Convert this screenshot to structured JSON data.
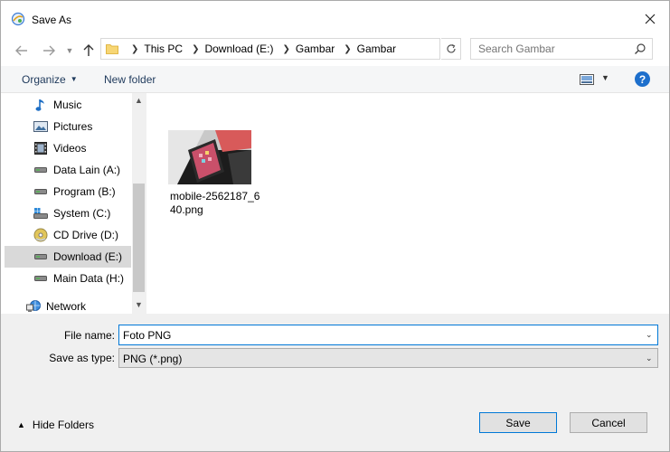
{
  "window": {
    "title": "Save As",
    "icon": "app-icon",
    "close_icon": "close-icon"
  },
  "address": {
    "crumbs": [
      "This PC",
      "Download (E:)",
      "Gambar",
      "Gambar"
    ],
    "search_placeholder": "Search Gambar"
  },
  "toolbar": {
    "organize_label": "Organize",
    "new_folder_label": "New folder"
  },
  "nav": {
    "items": [
      {
        "label": "Music",
        "icon": "music-icon"
      },
      {
        "label": "Pictures",
        "icon": "pictures-icon"
      },
      {
        "label": "Videos",
        "icon": "videos-icon"
      },
      {
        "label": "Data Lain (A:)",
        "icon": "drive-icon"
      },
      {
        "label": "Program (B:)",
        "icon": "drive-icon"
      },
      {
        "label": "System (C:)",
        "icon": "system-drive-icon"
      },
      {
        "label": "CD Drive (D:)",
        "icon": "cd-drive-icon"
      },
      {
        "label": "Download (E:)",
        "icon": "drive-icon",
        "selected": true
      },
      {
        "label": "Main Data (H:)",
        "icon": "drive-icon"
      },
      {
        "label": "Network",
        "icon": "network-icon"
      }
    ]
  },
  "files": [
    {
      "name": "mobile-2562187_640.png",
      "icon": "image-thumbnail"
    }
  ],
  "form": {
    "file_name_label": "File name:",
    "file_name_value": "Foto PNG",
    "save_type_label": "Save as type:",
    "save_type_value": "PNG (*.png)"
  },
  "footer": {
    "hide_folders_label": "Hide Folders",
    "save_label": "Save",
    "cancel_label": "Cancel"
  },
  "colors": {
    "accent": "#0078d7",
    "selection": "#d9d9d9",
    "help": "#1d6fcc",
    "folder": "#f7d674"
  }
}
